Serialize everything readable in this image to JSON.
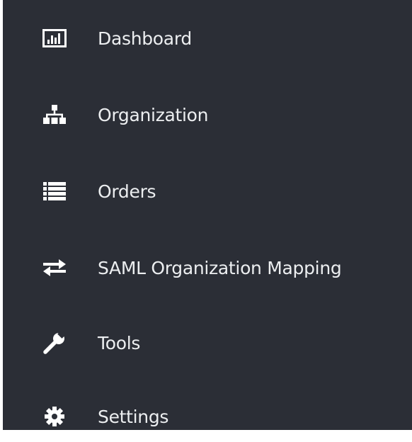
{
  "sidebar": {
    "items": [
      {
        "label": "Dashboard",
        "icon": "bar-chart-icon"
      },
      {
        "label": "Organization",
        "icon": "sitemap-icon"
      },
      {
        "label": "Orders",
        "icon": "list-icon"
      },
      {
        "label": "SAML Organization Mapping",
        "icon": "exchange-arrows-icon"
      },
      {
        "label": "Tools",
        "icon": "wrench-icon"
      },
      {
        "label": "Settings",
        "icon": "gear-icon"
      }
    ]
  },
  "colors": {
    "sidebar_background": "#2b2e36",
    "text": "#eceef0",
    "icon": "#ffffff"
  }
}
